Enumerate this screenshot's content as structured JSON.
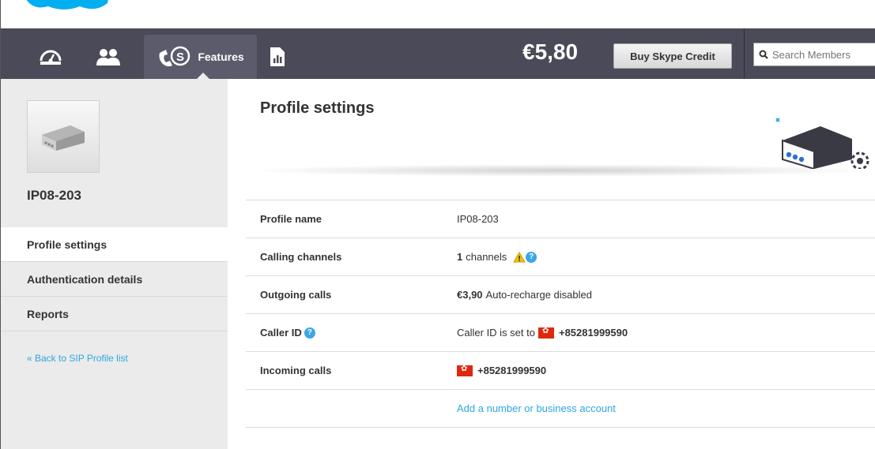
{
  "nav": {
    "features_label": "Features",
    "balance": "€5,80",
    "buy_credit_label": "Buy Skype Credit",
    "search_placeholder": "Search Members"
  },
  "sidebar": {
    "device_name": "IP08-203",
    "items": [
      {
        "label": "Profile settings",
        "active": true
      },
      {
        "label": "Authentication details",
        "active": false
      },
      {
        "label": "Reports",
        "active": false
      }
    ],
    "back_link": "« Back to SIP Profile list"
  },
  "main": {
    "title": "Profile settings",
    "rows": {
      "profile_name": {
        "label": "Profile name",
        "value": "IP08-203"
      },
      "calling_channels": {
        "label": "Calling channels",
        "count": "1",
        "unit": "channels"
      },
      "outgoing_calls": {
        "label": "Outgoing calls",
        "amount": "€3,90",
        "status": "Auto-recharge disabled"
      },
      "caller_id": {
        "label": "Caller ID",
        "prefix": "Caller ID is set to",
        "number": "+85281999590"
      },
      "incoming_calls": {
        "label": "Incoming calls",
        "number": "+85281999590"
      }
    },
    "add_link": "Add a number or business account"
  },
  "colors": {
    "navbar": "#4a4a58",
    "sidebar": "#ebebeb",
    "link": "#2aa8e0",
    "help_icon": "#3aa6e6",
    "flag": "#de2910"
  }
}
